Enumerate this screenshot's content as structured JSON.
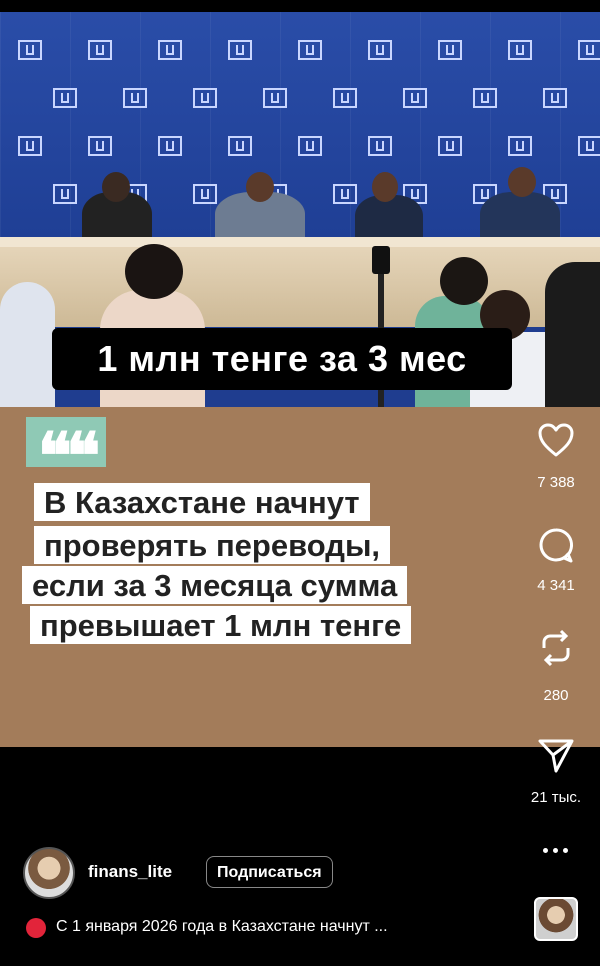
{
  "video": {
    "caption": "1 млн тенге за 3 мес"
  },
  "card": {
    "quote_mark": "❝❝",
    "headline_lines": [
      "В Казахстане начнут",
      "проверять переводы,",
      "если за 3 месяца сумма",
      "превышает 1 млн тенге"
    ]
  },
  "actions": {
    "like_count": "7 388",
    "comment_count": "4 341",
    "repost_count": "280",
    "share_count": "21 тыс."
  },
  "post": {
    "username": "finans_lite",
    "follow_label": "Подписаться",
    "description": "С 1 января 2026 года в Казахстане начнут ..."
  },
  "colors": {
    "card_bg": "#a37c5a",
    "quote_accent": "#8fc9b5",
    "backdrop_blue": "#2a4da8",
    "record_dot": "#e2243a"
  }
}
